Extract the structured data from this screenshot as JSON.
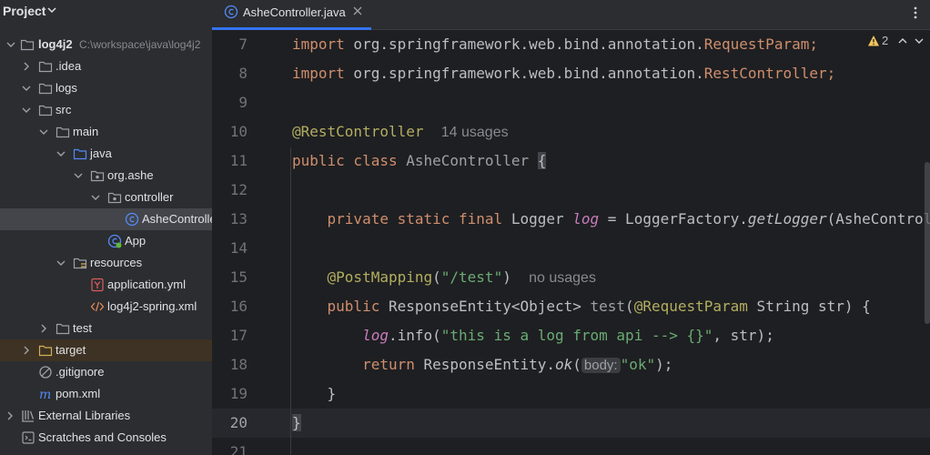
{
  "project": {
    "title": "Project",
    "tree": [
      {
        "label": "log4j2",
        "path": "C:\\workspace\\java\\log4j2",
        "bold": true
      },
      {
        "label": ".idea"
      },
      {
        "label": "logs"
      },
      {
        "label": "src"
      },
      {
        "label": "main"
      },
      {
        "label": "java"
      },
      {
        "label": "org.ashe"
      },
      {
        "label": "controller"
      },
      {
        "label": "AsheController"
      },
      {
        "label": "App"
      },
      {
        "label": "resources"
      },
      {
        "label": "application.yml"
      },
      {
        "label": "log4j2-spring.xml"
      },
      {
        "label": "test"
      },
      {
        "label": "target"
      },
      {
        "label": ".gitignore"
      },
      {
        "label": "pom.xml"
      },
      {
        "label": "External Libraries"
      },
      {
        "label": "Scratches and Consoles"
      }
    ]
  },
  "editor": {
    "tab_label": "AsheController.java",
    "inspection_count": "2",
    "lines": {
      "n7": "7",
      "n8": "8",
      "n9": "9",
      "n10": "10",
      "n11": "11",
      "n12": "12",
      "n13": "13",
      "n14": "14",
      "n15": "15",
      "n16": "16",
      "n17": "17",
      "n18": "18",
      "n19": "19",
      "n20": "20",
      "n21": "21"
    },
    "code": {
      "import_kw": "import",
      "l7_pkg": " org.springframework.web.bind.annotation.",
      "l7_cls": "RequestParam",
      "l8_pkg": " org.springframework.web.bind.annotation.",
      "l8_cls": "RestController",
      "semi": ";",
      "l10_ann": "@RestController",
      "l10_hint": "14 usages",
      "l11_kw": "public class",
      "l11_name": " AsheController ",
      "l11_brace": "{",
      "l13_kw": "private static final",
      "l13_type": " Logger ",
      "l13_field": "log",
      "l13_eq": " = LoggerFactory.",
      "l13_call": "getLogger",
      "l13_rest": "(AsheController.class);",
      "l15_ann": "@PostMapping",
      "l15_open": "(",
      "l15_str": "\"/test\"",
      "l15_close": ")",
      "l15_hint": "no usages",
      "l16_kw": "public",
      "l16_type": " ResponseEntity<Object> ",
      "l16_name": "test",
      "l16_open": "(",
      "l16_ann": "@RequestParam",
      "l16_rest": " String str) {",
      "l17_field": "log",
      "l17_call": ".info(",
      "l17_str": "\"this is a log from api --> {}\"",
      "l17_rest": ", str);",
      "l18_kw": "return",
      "l18_pre": " ResponseEntity.",
      "l18_call": "ok",
      "l18_open": "(",
      "l18_inlay": "body:",
      "l18_str": "\"ok\"",
      "l18_rest": ");",
      "l19": "}",
      "l20": "}"
    }
  },
  "colors": {
    "accent": "#3574f0",
    "keyword": "#cf8e6d",
    "annotation": "#b3ae60",
    "string": "#6aab73",
    "field": "#c77dbb",
    "warning": "#f2c55c"
  }
}
